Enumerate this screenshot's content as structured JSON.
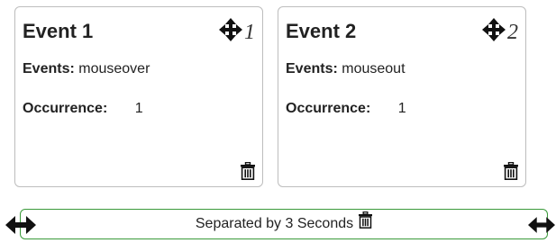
{
  "cards": [
    {
      "title": "Event 1",
      "number": "1",
      "events_label": "Events:",
      "events_value": "mouseover",
      "occurrence_label": "Occurrence:",
      "occurrence_value": "1"
    },
    {
      "title": "Event 2",
      "number": "2",
      "events_label": "Events:",
      "events_value": "mouseout",
      "occurrence_label": "Occurrence:",
      "occurrence_value": "1"
    }
  ],
  "separator": {
    "text": "Separated by 3 Seconds",
    "border_color": "#3a9a3a"
  },
  "icons": {
    "move": "move-arrows-icon",
    "delete": "trash-icon",
    "resize": "horizontal-resize-arrow-icon"
  }
}
